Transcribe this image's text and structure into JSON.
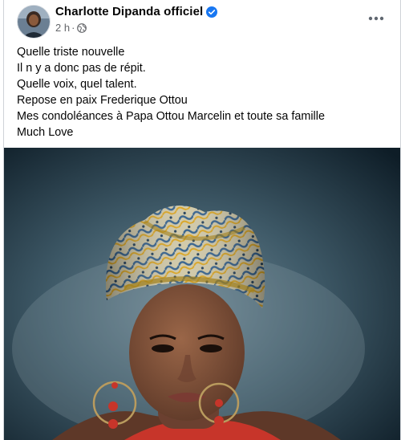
{
  "post": {
    "author": "Charlotte Dipanda officiel",
    "timestamp": "2 h",
    "separator": "·",
    "more_icon": "more-horizontal-icon",
    "verified_icon": "verified-badge-icon",
    "audience_icon": "globe-icon",
    "lines": [
      "Quelle triste nouvelle",
      "Il n y a donc pas de répit.",
      "Quelle voix, quel talent.",
      "Repose en paix Frederique Ottou",
      "Mes condoléances à Papa Ottou Marcelin et toute sa famille",
      "Much Love"
    ]
  },
  "colors": {
    "verified_blue": "#1877f2",
    "meta_gray": "#65676b",
    "text": "#050505"
  }
}
